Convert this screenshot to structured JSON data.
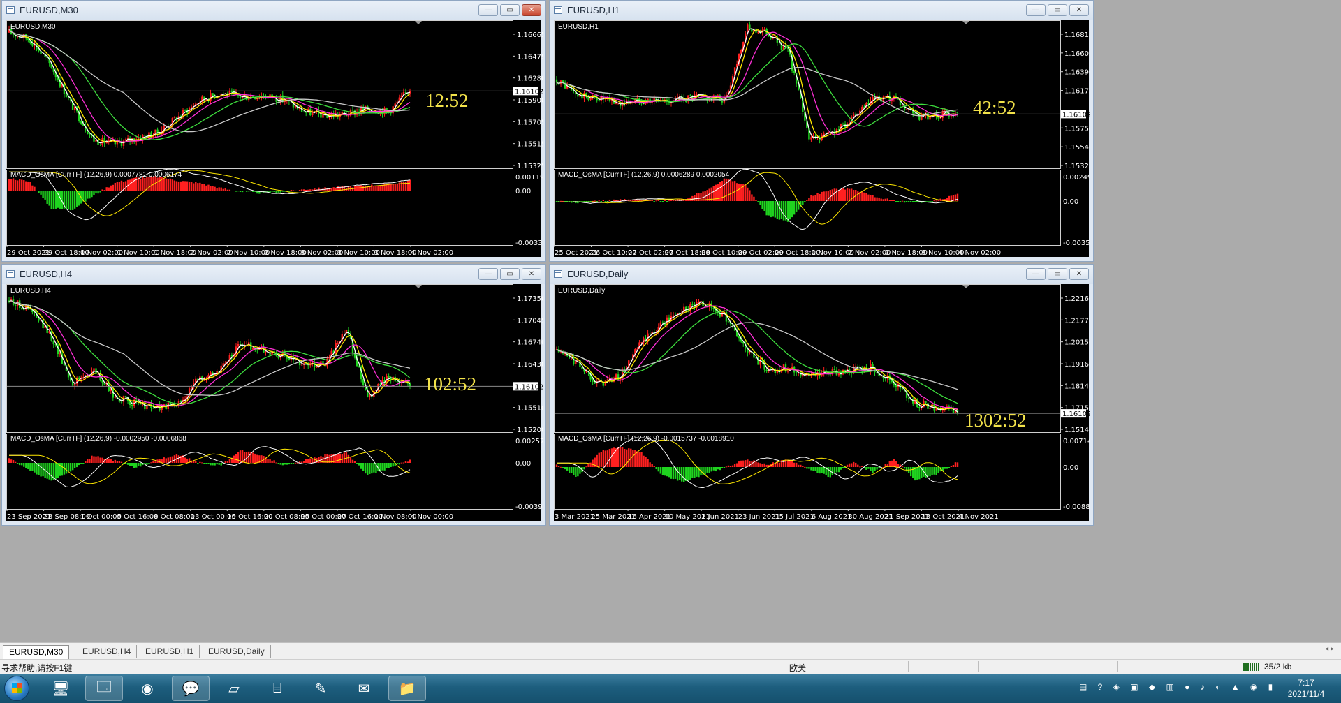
{
  "windows": [
    {
      "id": "m30",
      "title": "EURUSD,M30",
      "symbol": "EURUSD,M30",
      "close_state": "active",
      "timer": "12:52",
      "price_current": "1.16102",
      "y_labels": [
        "1.16665",
        "1.16475",
        "1.16280",
        "1.15900",
        "1.15705",
        "1.15515",
        "1.15325"
      ],
      "macd_label": "MACD_OsMA [CurrTF] (12,26,9) 0.0007781 0.0006174",
      "macd_y_labels": [
        "0.001195",
        "0.00",
        "-0.003331"
      ],
      "x_labels": [
        "29 Oct 2021",
        "29 Oct 18:00",
        "1 Nov 02:00",
        "1 Nov 10:00",
        "1 Nov 18:00",
        "2 Nov 02:00",
        "2 Nov 10:00",
        "2 Nov 18:00",
        "3 Nov 02:00",
        "3 Nov 10:00",
        "3 Nov 18:00",
        "4 Nov 02:00"
      ],
      "series": {
        "price": [
          0.95,
          0.9,
          0.7,
          0.4,
          0.15,
          0.12,
          0.16,
          0.2,
          0.32,
          0.44,
          0.5,
          0.47,
          0.48,
          0.45,
          0.36,
          0.33,
          0.34,
          0.38,
          0.36,
          0.53
        ],
        "macd": [
          0.5,
          0.35,
          -0.7,
          -0.75,
          -0.2,
          0.3,
          0.5,
          0.55,
          0.4,
          0.3,
          0.1,
          -0.05,
          -0.1,
          -0.05,
          0.05,
          0.1,
          0.15,
          0.2,
          0.25,
          0.4
        ]
      }
    },
    {
      "id": "h1",
      "title": "EURUSD,H1",
      "symbol": "EURUSD,H1",
      "close_state": "inactive",
      "timer": "42:52",
      "price_current": "1.16102",
      "y_labels": [
        "1.16815",
        "1.16605",
        "1.16390",
        "1.16175",
        "1.15965",
        "1.15750",
        "1.15540",
        "1.15325"
      ],
      "macd_label": "MACD_OsMA [CurrTF] (12,26,9) 0.0006289 0.0002054",
      "macd_y_labels": [
        "0.002497",
        "0.00",
        "-0.003570"
      ],
      "x_labels": [
        "25 Oct 2021",
        "26 Oct 10:00",
        "27 Oct 02:00",
        "27 Oct 18:00",
        "28 Oct 10:00",
        "29 Oct 02:00",
        "29 Oct 18:00",
        "1 Nov 10:00",
        "2 Nov 02:00",
        "2 Nov 18:00",
        "3 Nov 10:00",
        "4 Nov 02:00"
      ],
      "series": {
        "price": [
          0.6,
          0.48,
          0.46,
          0.42,
          0.45,
          0.44,
          0.46,
          0.47,
          0.45,
          0.98,
          0.95,
          0.8,
          0.15,
          0.2,
          0.3,
          0.45,
          0.45,
          0.32,
          0.33,
          0.36
        ],
        "macd": [
          0.0,
          -0.05,
          0.0,
          0.05,
          0.05,
          0.02,
          0.05,
          0.4,
          0.9,
          0.6,
          -0.6,
          -0.8,
          0.2,
          0.45,
          0.5,
          0.2,
          0.0,
          -0.05,
          0.0,
          0.3
        ]
      }
    },
    {
      "id": "h4",
      "title": "EURUSD,H4",
      "symbol": "EURUSD,H4",
      "close_state": "inactive",
      "timer": "102:52",
      "price_current": "1.16102",
      "y_labels": [
        "1.17350",
        "1.17045",
        "1.16740",
        "1.16430",
        "1.15815",
        "1.15510",
        "1.15200"
      ],
      "macd_label": "MACD_OsMA [CurrTF] (12,26,9) -0.0002950 -0.0006868",
      "macd_y_labels": [
        "0.002577",
        "0.00",
        "-0.003921"
      ],
      "x_labels": [
        "23 Sep 2021",
        "28 Sep 08:00",
        "1 Oct 00:00",
        "5 Oct 16:00",
        "8 Oct 08:00",
        "13 Oct 00:00",
        "15 Oct 16:00",
        "20 Oct 08:00",
        "25 Oct 00:00",
        "27 Oct 16:00",
        "1 Nov 08:00",
        "4 Nov 00:00"
      ],
      "series": {
        "price": [
          0.92,
          0.85,
          0.65,
          0.3,
          0.4,
          0.2,
          0.15,
          0.12,
          0.14,
          0.34,
          0.4,
          0.6,
          0.55,
          0.5,
          0.45,
          0.45,
          0.7,
          0.2,
          0.35,
          0.3
        ],
        "macd": [
          0.2,
          -0.3,
          -0.7,
          -0.3,
          0.3,
          0.1,
          -0.2,
          0.1,
          0.35,
          0.0,
          -0.1,
          0.5,
          0.3,
          -0.1,
          0.1,
          0.3,
          0.4,
          -0.5,
          -0.2,
          0.1
        ]
      }
    },
    {
      "id": "daily",
      "title": "EURUSD,Daily",
      "symbol": "EURUSD,Daily",
      "close_state": "inactive",
      "timer": "1302:52",
      "price_current": "1.16102",
      "y_labels": [
        "1.22160",
        "1.21770",
        "1.20150",
        "1.19160",
        "1.18140",
        "1.17150",
        "1.15140"
      ],
      "macd_label": "MACD_OsMA [CurrTF] (12,26,9) -0.0015737 -0.0018910",
      "macd_y_labels": [
        "0.007143",
        "0.00",
        "-0.008882"
      ],
      "x_labels": [
        "3 Mar 2021",
        "25 Mar 2021",
        "16 Apr 2021",
        "10 May 2021",
        "1 Jun 2021",
        "23 Jun 2021",
        "15 Jul 2021",
        "6 Aug 2021",
        "30 Aug 2021",
        "21 Sep 2021",
        "13 Oct 2021",
        "4 Nov 2021"
      ],
      "series": {
        "price": [
          0.55,
          0.45,
          0.3,
          0.35,
          0.6,
          0.75,
          0.85,
          0.9,
          0.8,
          0.55,
          0.4,
          0.42,
          0.35,
          0.38,
          0.4,
          0.42,
          0.3,
          0.15,
          0.12,
          0.1
        ],
        "macd": [
          0.1,
          -0.4,
          0.6,
          0.8,
          0.6,
          -0.3,
          -0.6,
          -0.3,
          0.0,
          0.3,
          0.1,
          0.3,
          -0.1,
          -0.4,
          0.2,
          -0.2,
          0.3,
          -0.5,
          -0.3,
          0.2
        ]
      }
    }
  ],
  "tabs": [
    "EURUSD,M30",
    "EURUSD,H4",
    "EURUSD,H1",
    "EURUSD,Daily"
  ],
  "active_tab": 0,
  "status": {
    "help": "寻求帮助,请按F1键",
    "profile": "欧美",
    "traffic": "35/2 kb"
  },
  "taskbar": {
    "icons": [
      "desktop-icon",
      "explorer-icon",
      "browser-icon",
      "wechat-icon",
      "notepad-icon",
      "network-icon",
      "paint-icon",
      "messenger-icon",
      "folder-icon"
    ],
    "time": "7:17",
    "date": "2021/11/4"
  },
  "colors": {
    "bull": "#ff2020",
    "bear": "#1fd41f",
    "ma_white": "#ffffff",
    "ma_yellow": "#ffe800",
    "ma_magenta": "#ff2fd8",
    "ma_green": "#3ede3e",
    "ma_silver": "#c9c9c9",
    "timer": "#f2e24a"
  }
}
